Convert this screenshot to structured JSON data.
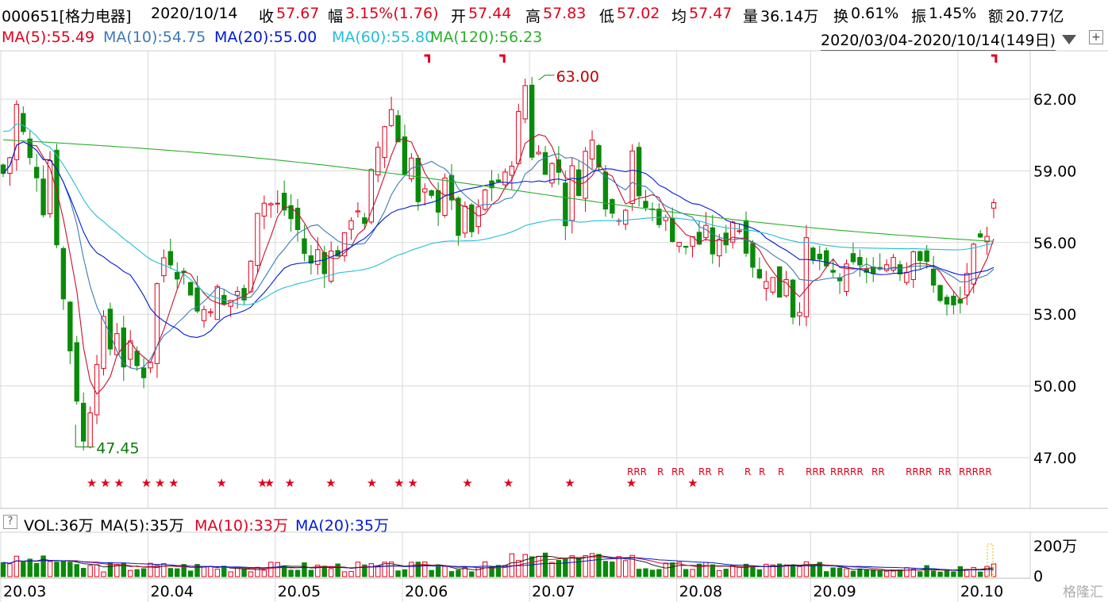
{
  "header": {
    "code": "000651[格力电器]",
    "date": "2020/10/14",
    "close_label": "收",
    "close": "57.67",
    "change_label": "幅",
    "change": "3.15%(1.76)",
    "open_label": "开",
    "open": "57.44",
    "high_label": "高",
    "high": "57.83",
    "low_label": "低",
    "low": "57.02",
    "avg_label": "均",
    "avg": "57.47",
    "vol_label": "量",
    "vol": "36.14万",
    "turnover_label": "换",
    "turnover": "0.61%",
    "amp_label": "振",
    "amp": "1.45%",
    "amount_label": "额",
    "amount": "20.77亿"
  },
  "ma_legend": {
    "ma5": "MA(5):55.49",
    "ma10": "MA(10):54.75",
    "ma20": "MA(20):55.00",
    "ma60": "MA(60):55.80",
    "ma120": "MA(120):56.23"
  },
  "date_range": "2020/03/04-2020/10/14(149日)",
  "volume_header": {
    "vol": "VOL:36万",
    "ma5": "MA(5):35万",
    "ma10": "MA(10):33万",
    "ma20": "MA(20):35万"
  },
  "watermark": "格隆汇",
  "colors": {
    "up": "#e0001b",
    "down": "#0a8a0a",
    "ma5": "#c8102e",
    "ma10": "#3d7ab8",
    "ma20": "#0019d6",
    "ma60": "#22bfd6",
    "ma120": "#2ab02a",
    "grid": "#d9d9d9"
  },
  "chart_data": {
    "type": "candlestick",
    "y_ticks": [
      47,
      50,
      53,
      56,
      59,
      62
    ],
    "y_tick_labels": [
      "47.00",
      "50.00",
      "53.00",
      "56.00",
      "59.00",
      "62.00"
    ],
    "ylim": [
      45.8,
      64.1
    ],
    "x_labels": [
      "20.03",
      "20.04",
      "20.05",
      "20.06",
      "20.07",
      "20.08",
      "20.09",
      "20.10"
    ],
    "x_label_index": [
      0,
      22,
      41,
      60,
      79,
      101,
      121,
      143
    ],
    "high_annotation": {
      "value": "63.00",
      "index": 80
    },
    "low_annotation": {
      "value": "47.45",
      "index": 12
    },
    "series_path": [
      [
        0,
        58.9
      ],
      [
        1,
        59.6
      ],
      [
        2,
        61.7
      ],
      [
        3,
        60.5
      ],
      [
        4,
        59.4
      ],
      [
        5,
        59.0
      ],
      [
        6,
        57.5
      ],
      [
        7,
        59.5
      ],
      [
        8,
        56.2
      ],
      [
        9,
        53.6
      ],
      [
        10,
        51.6
      ],
      [
        11,
        49.6
      ],
      [
        12,
        47.6
      ],
      [
        13,
        49.2
      ],
      [
        14,
        51.3
      ],
      [
        15,
        52.5
      ],
      [
        16,
        51.6
      ],
      [
        17,
        52.4
      ],
      [
        18,
        51.0
      ],
      [
        19,
        51.5
      ],
      [
        20,
        50.8
      ],
      [
        21,
        50.6
      ],
      [
        22,
        51.2
      ],
      [
        23,
        54.2
      ],
      [
        24,
        55.4
      ],
      [
        25,
        54.9
      ],
      [
        26,
        54.6
      ],
      [
        27,
        54.1
      ],
      [
        28,
        53.1
      ],
      [
        29,
        53.2
      ],
      [
        30,
        53.5
      ],
      [
        31,
        53.9
      ],
      [
        32,
        53.3
      ],
      [
        33,
        53.6
      ],
      [
        34,
        54.0
      ],
      [
        35,
        53.4
      ],
      [
        36,
        55.6
      ],
      [
        37,
        57.5
      ],
      [
        38,
        57.7
      ],
      [
        39,
        57.6
      ],
      [
        40,
        57.5
      ],
      [
        41,
        57.4
      ],
      [
        42,
        57.0
      ],
      [
        43,
        56.5
      ],
      [
        44,
        55.6
      ],
      [
        45,
        55.0
      ],
      [
        46,
        55.7
      ],
      [
        47,
        55.1
      ],
      [
        48,
        55.5
      ],
      [
        49,
        55.7
      ],
      [
        50,
        56.0
      ],
      [
        51,
        57.2
      ],
      [
        52,
        57.5
      ],
      [
        53,
        56.5
      ],
      [
        54,
        58.7
      ],
      [
        55,
        60.0
      ],
      [
        56,
        61.0
      ],
      [
        57,
        61.6
      ],
      [
        58,
        60.3
      ],
      [
        59,
        59.2
      ],
      [
        60,
        59.5
      ],
      [
        61,
        57.5
      ],
      [
        62,
        57.9
      ],
      [
        63,
        57.7
      ],
      [
        64,
        57.6
      ],
      [
        65,
        58.9
      ],
      [
        66,
        57.4
      ],
      [
        67,
        56.5
      ],
      [
        68,
        57.1
      ],
      [
        69,
        56.4
      ],
      [
        70,
        57.2
      ],
      [
        71,
        58.1
      ],
      [
        72,
        58.4
      ],
      [
        73,
        58.6
      ],
      [
        74,
        59.6
      ],
      [
        75,
        61.2
      ],
      [
        76,
        62.6
      ],
      [
        77,
        59.8
      ],
      [
        78,
        59.7
      ],
      [
        79,
        59.3
      ],
      [
        80,
        59.2
      ],
      [
        81,
        59.0
      ],
      [
        82,
        57.0
      ],
      [
        83,
        58.9
      ],
      [
        84,
        58.4
      ],
      [
        85,
        59.7
      ],
      [
        86,
        60.2
      ],
      [
        87,
        59.6
      ],
      [
        88,
        57.8
      ],
      [
        89,
        57.2
      ],
      [
        90,
        57.3
      ],
      [
        91,
        57.7
      ],
      [
        92,
        60.0
      ],
      [
        93,
        57.6
      ],
      [
        94,
        57.5
      ],
      [
        95,
        57.3
      ],
      [
        96,
        57.1
      ],
      [
        97,
        56.8
      ],
      [
        98,
        56.4
      ],
      [
        99,
        56.1
      ],
      [
        100,
        55.6
      ],
      [
        101,
        56.3
      ],
      [
        102,
        56.0
      ],
      [
        103,
        56.3
      ],
      [
        104,
        55.7
      ],
      [
        105,
        55.8
      ],
      [
        106,
        56.2
      ],
      [
        107,
        57.0
      ],
      [
        108,
        56.6
      ],
      [
        109,
        56.0
      ],
      [
        110,
        55.2
      ],
      [
        111,
        54.4
      ],
      [
        112,
        54.7
      ],
      [
        113,
        54.4
      ],
      [
        114,
        53.9
      ],
      [
        115,
        54.7
      ],
      [
        116,
        53.1
      ],
      [
        117,
        53.5
      ],
      [
        118,
        55.8
      ],
      [
        119,
        55.1
      ],
      [
        120,
        55.3
      ],
      [
        121,
        54.6
      ],
      [
        122,
        54.5
      ],
      [
        123,
        54.7
      ],
      [
        124,
        54.9
      ],
      [
        125,
        55.2
      ],
      [
        126,
        54.7
      ],
      [
        127,
        54.4
      ],
      [
        128,
        55.3
      ],
      [
        129,
        55.1
      ],
      [
        130,
        55.5
      ],
      [
        131,
        55.0
      ],
      [
        132,
        54.9
      ],
      [
        133,
        56.0
      ],
      [
        134,
        55.4
      ],
      [
        135,
        54.9
      ],
      [
        136,
        54.1
      ],
      [
        137,
        53.8
      ],
      [
        138,
        53.3
      ],
      [
        139,
        53.2
      ],
      [
        140,
        53.4
      ],
      [
        141,
        54.8
      ],
      [
        142,
        55.5
      ],
      [
        143,
        55.8
      ],
      [
        144,
        56.0
      ],
      [
        145,
        57.5
      ]
    ],
    "note_flags": [
      62,
      73,
      145
    ],
    "star_markers": [
      13,
      15,
      17,
      21,
      23,
      25,
      32,
      38,
      39,
      42,
      48,
      54,
      58,
      60,
      68,
      74,
      83,
      92,
      101
    ],
    "r_markers": [
      55,
      57,
      59,
      61,
      64,
      66,
      69,
      71,
      73,
      75,
      77,
      79,
      83,
      85,
      89,
      91,
      93,
      95,
      97,
      99,
      101,
      104,
      108,
      110,
      112,
      114,
      116,
      118,
      119,
      120,
      121
    ],
    "volume_ticks": [
      200,
      0
    ],
    "volume_tick_labels": [
      "200万",
      "0"
    ],
    "volume_ylim": [
      0,
      230
    ]
  }
}
